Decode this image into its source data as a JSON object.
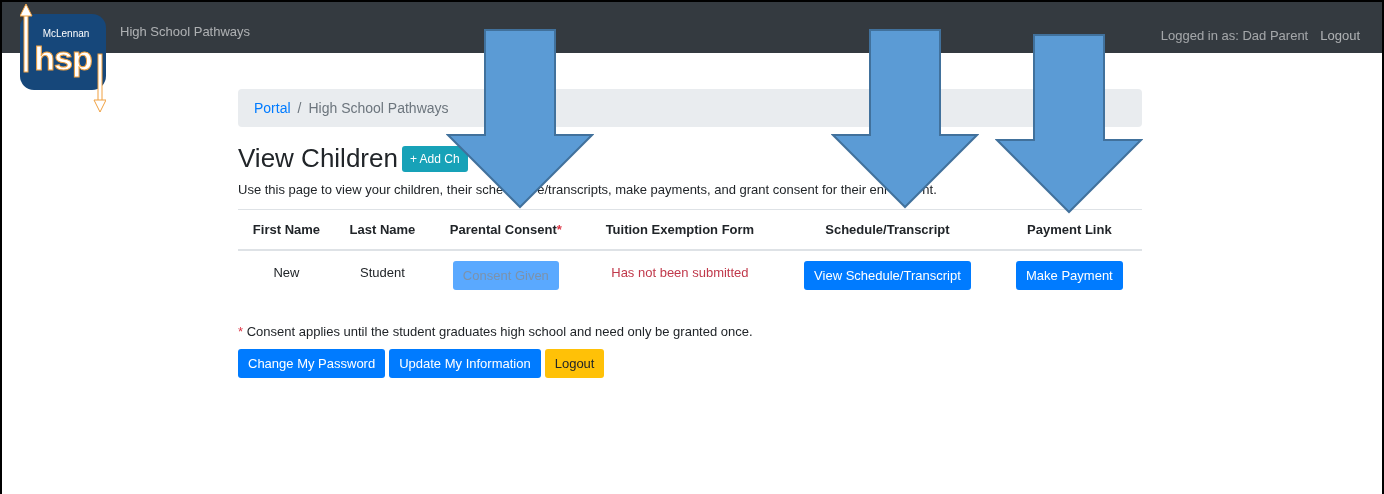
{
  "navbar": {
    "logo": {
      "top_text": "McLennan",
      "main_text": "hsp"
    },
    "brand": "High School Pathways",
    "user_label": "Logged in as: Dad Parent",
    "logout": "Logout"
  },
  "breadcrumb": {
    "items": [
      {
        "label": "Portal",
        "link": true
      },
      {
        "label": "High School Pathways",
        "link": false
      }
    ],
    "separator": "/"
  },
  "heading": "View Children",
  "add_button": "+ Add Ch",
  "description": [
    "Use this page to view your children, their sche",
    "e/transcripts, make payments, and grant consent for their enr",
    "nt."
  ],
  "table": {
    "columns": [
      {
        "label": "First Name"
      },
      {
        "label": "Last Name"
      },
      {
        "label": "Parental Consent",
        "mark": "*"
      },
      {
        "label": "Tuition Exemption Form"
      },
      {
        "label": "Schedule/Transcript"
      },
      {
        "label": "Payment Link"
      }
    ],
    "rows": [
      {
        "first_name": "New",
        "last_name": "Student",
        "consent": {
          "label": "Consent Given",
          "disabled": true
        },
        "tuition_status": "Has not been submitted",
        "schedule_button": "View Schedule/Transcript",
        "payment_button": "Make Payment"
      }
    ]
  },
  "footnote": {
    "mark": "*",
    "text": "Consent applies until the student graduates high school and need only be granted once."
  },
  "buttons": [
    {
      "label": "Change My Password",
      "kind": "primary"
    },
    {
      "label": "Update My Information",
      "kind": "primary"
    },
    {
      "label": "Logout",
      "kind": "warning"
    }
  ]
}
